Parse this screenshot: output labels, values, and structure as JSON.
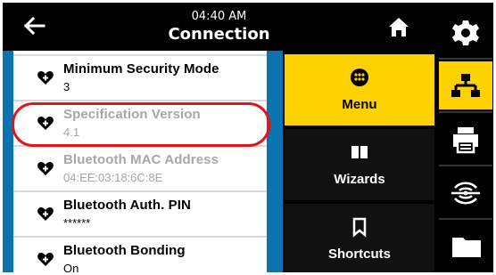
{
  "header": {
    "time": "04:40 AM",
    "title": "Connection"
  },
  "list": {
    "items": [
      {
        "label": "Minimum Security Mode",
        "value": "3",
        "enabled": true
      },
      {
        "label": "Specification Version",
        "value": "4.1",
        "enabled": false
      },
      {
        "label": "Bluetooth MAC Address",
        "value": "04:EE:03:18:6C:8E",
        "enabled": false
      },
      {
        "label": "Bluetooth Auth. PIN",
        "value": "******",
        "enabled": true
      },
      {
        "label": "Bluetooth Bonding",
        "value": "On",
        "enabled": true
      }
    ]
  },
  "menu": {
    "items": [
      {
        "label": "Menu",
        "icon": "menu-dots-icon",
        "active": true
      },
      {
        "label": "Wizards",
        "icon": "book-icon",
        "active": false
      },
      {
        "label": "Shortcuts",
        "icon": "bookmark-icon",
        "active": false
      }
    ]
  },
  "sidebar": {
    "items": [
      {
        "icon": "gear-icon",
        "active": false
      },
      {
        "icon": "network-icon",
        "active": true
      },
      {
        "icon": "printer-icon",
        "active": false
      },
      {
        "icon": "wireless-icon",
        "active": false
      },
      {
        "icon": "folder-icon",
        "active": false
      }
    ]
  },
  "colors": {
    "accent_yellow": "#fed100",
    "list_blue": "#0a73b0",
    "highlight_red": "#e0161b",
    "disabled_text": "#a7a7a7"
  }
}
